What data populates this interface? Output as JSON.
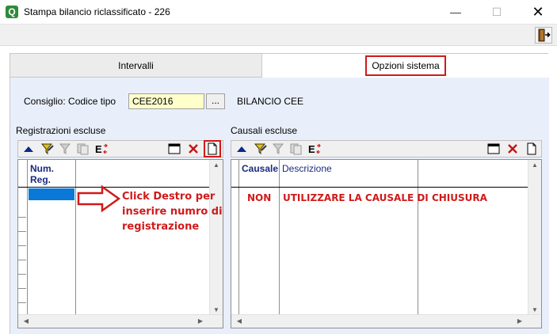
{
  "window": {
    "title": "Stampa bilancio riclassificato - 226",
    "app_icon_letter": "Q",
    "minimize": "—",
    "maximize": "☐",
    "close": "✕"
  },
  "tabs": [
    {
      "label": "Intervalli"
    },
    {
      "label": "Opzioni sistema"
    }
  ],
  "consiglio": {
    "label": "Consiglio: Codice tipo",
    "value": "CEE2016",
    "browse_label": "...",
    "description": "BILANCIO CEE"
  },
  "registrazioni": {
    "section_label": "Registrazioni escluse",
    "columns": [
      "Num. Reg.",
      ""
    ]
  },
  "causali": {
    "section_label": "Causali escluse",
    "columns": [
      "Causale",
      "Descrizione",
      ""
    ]
  },
  "annotations": {
    "left_note": [
      "Click Destro per",
      "inserire numro di",
      "registrazione"
    ],
    "right_code": "NON",
    "right_desc": "UTILIZZARE LA CAUSALE DI CHIUSURA"
  },
  "colors": {
    "accent_red": "#d01a1a",
    "selection_blue": "#0a78d7",
    "input_yellow": "#ffffcc",
    "header_text": "#1a2a80"
  }
}
